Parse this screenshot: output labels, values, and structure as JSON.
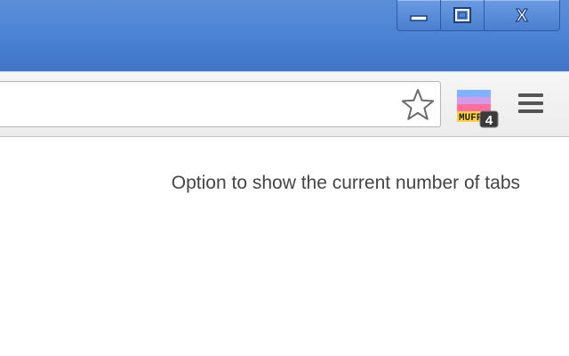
{
  "window": {
    "controls": [
      "minimize-icon",
      "maximize-icon",
      "close-icon"
    ],
    "close_label": "X"
  },
  "toolbar": {
    "bookmark_icon": "star-outline-icon",
    "extension": {
      "icon": "muff-extension-icon",
      "logo_text": "MUFF",
      "badge_count": "4"
    },
    "menu_icon": "hamburger-menu-icon"
  },
  "content": {
    "caption": "Option to show the current number of tabs"
  },
  "colors": {
    "titlebar": "#4f86d6",
    "toolbar": "#f0f0f0",
    "caption_text": "#444444"
  }
}
